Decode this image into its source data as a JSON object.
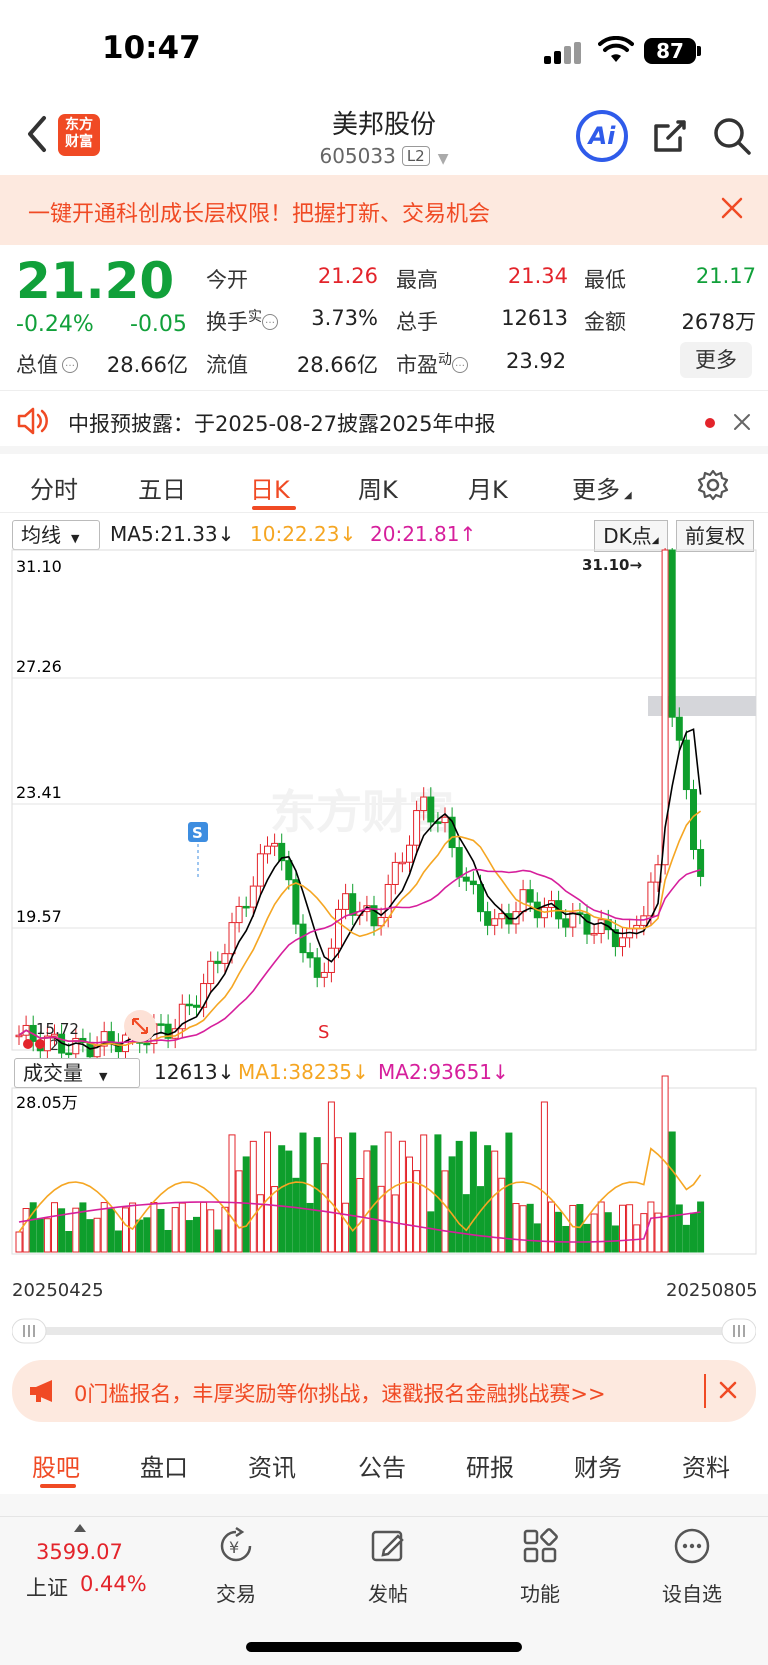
{
  "status": {
    "time": "10:47",
    "battery": "87"
  },
  "nav": {
    "logo_line1": "东方",
    "logo_line2": "财富",
    "title": "美邦股份",
    "code": "605033",
    "level": "L2",
    "ai_label": "Ai"
  },
  "banner": {
    "text": "一键开通科创成长层权限！把握打新、交易机会"
  },
  "quote": {
    "price": "21.20",
    "pct": "-0.24%",
    "chg": "-0.05",
    "open_label": "今开",
    "open": "21.26",
    "high_label": "最高",
    "high": "21.34",
    "low_label": "最低",
    "low": "21.17",
    "turnover_label": "换手",
    "turnover_sup": "实",
    "turnover": "3.73%",
    "volume_label": "总手",
    "volume": "12613",
    "amount_label": "金额",
    "amount": "2678万",
    "mktcap_label": "总值",
    "mktcap": "28.66亿",
    "float_label": "流值",
    "float": "28.66亿",
    "pe_label": "市盈",
    "pe_sup": "动",
    "pe": "23.92",
    "more": "更多"
  },
  "notice": {
    "text": "中报预披露：于2025-08-27披露2025年中报"
  },
  "ktabs": [
    "分时",
    "五日",
    "日K",
    "周K",
    "月K",
    "更多"
  ],
  "ma": {
    "selector": "均线",
    "ma5": "MA5:21.33↓",
    "ma10": "10:22.23↓",
    "ma20": "20:21.81↑",
    "dk": "DK点",
    "fq": "前复权"
  },
  "chart_data": {
    "type": "candlestick",
    "y_ticks": [
      "31.10",
      "27.26",
      "23.41",
      "19.57"
    ],
    "annotation_high": "31.10→",
    "annotation_low": "15.72",
    "low_marker": "2",
    "signal_buy": "S",
    "signal_sell": "S",
    "colors": {
      "up": "#e3242b",
      "down": "#0e9e2c",
      "ma5": "#000000",
      "ma10": "#f5a623",
      "ma20": "#d61f9c"
    }
  },
  "volume": {
    "selector": "成交量",
    "value": "12613↓",
    "ma1": "MA1:38235↓",
    "ma2": "MA2:93651↓",
    "max": "28.05万",
    "start_date": "20250425",
    "end_date": "20250805"
  },
  "promo2": {
    "text": "0门槛报名，丰厚奖励等你挑战，速戳报名金融挑战赛>>"
  },
  "btabs": [
    "股吧",
    "盘口",
    "资讯",
    "公告",
    "研报",
    "财务",
    "资料"
  ],
  "bottom": {
    "index_value": "3599.07",
    "index_name": "上证",
    "index_pct": "0.44%",
    "items": [
      {
        "label": "交易"
      },
      {
        "label": "发帖"
      },
      {
        "label": "功能"
      },
      {
        "label": "设自选"
      }
    ]
  }
}
